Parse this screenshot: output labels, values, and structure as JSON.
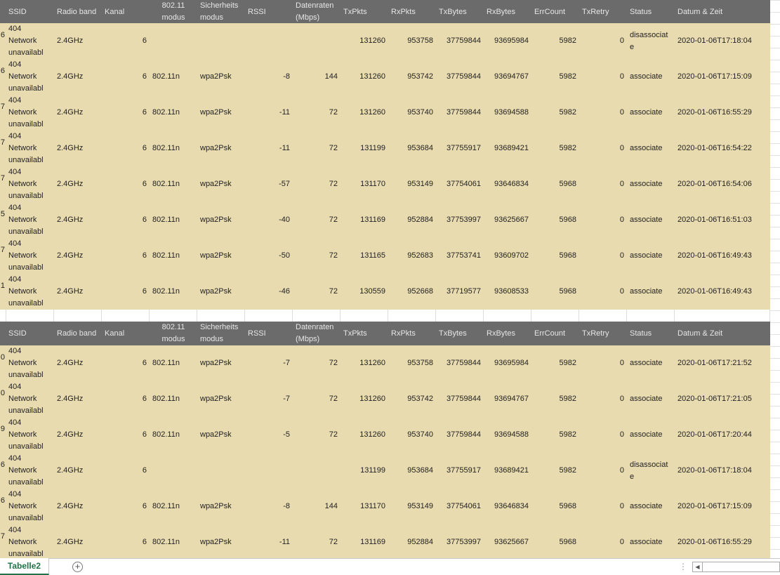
{
  "headers": [
    "",
    "SSID",
    "Radio band",
    "Kanal",
    "802.11 modus",
    "Sicherheits modus",
    "RSSI",
    "Datenraten (Mbps)",
    "TxPkts",
    "RxPkts",
    "TxBytes",
    "RxBytes",
    "ErrCount",
    "TxRetry",
    "Status",
    "Datum & Zeit"
  ],
  "ssid_lines": [
    "404",
    "Network",
    "unavailabl"
  ],
  "table1": [
    [
      "6",
      "404 Network unavailabl",
      "2.4GHz",
      "6",
      "",
      "",
      "",
      "",
      "131260",
      "953758",
      "37759844",
      "93695984",
      "5982",
      "0",
      "disassociate",
      "2020-01-06T17:18:04"
    ],
    [
      "6",
      "404 Network unavailabl",
      "2.4GHz",
      "6",
      "802.11n",
      "wpa2Psk",
      "-8",
      "144",
      "131260",
      "953742",
      "37759844",
      "93694767",
      "5982",
      "0",
      "associate",
      "2020-01-06T17:15:09"
    ],
    [
      "7",
      "404 Network unavailabl",
      "2.4GHz",
      "6",
      "802.11n",
      "wpa2Psk",
      "-11",
      "72",
      "131260",
      "953740",
      "37759844",
      "93694588",
      "5982",
      "0",
      "associate",
      "2020-01-06T16:55:29"
    ],
    [
      "7",
      "404 Network unavailabl",
      "2.4GHz",
      "6",
      "802.11n",
      "wpa2Psk",
      "-11",
      "72",
      "131199",
      "953684",
      "37755917",
      "93689421",
      "5982",
      "0",
      "associate",
      "2020-01-06T16:54:22"
    ],
    [
      "7",
      "404 Network unavailabl",
      "2.4GHz",
      "6",
      "802.11n",
      "wpa2Psk",
      "-57",
      "72",
      "131170",
      "953149",
      "37754061",
      "93646834",
      "5968",
      "0",
      "associate",
      "2020-01-06T16:54:06"
    ],
    [
      "5",
      "404 Network unavailabl",
      "2.4GHz",
      "6",
      "802.11n",
      "wpa2Psk",
      "-40",
      "72",
      "131169",
      "952884",
      "37753997",
      "93625667",
      "5968",
      "0",
      "associate",
      "2020-01-06T16:51:03"
    ],
    [
      "7",
      "404 Network unavailabl",
      "2.4GHz",
      "6",
      "802.11n",
      "wpa2Psk",
      "-50",
      "72",
      "131165",
      "952683",
      "37753741",
      "93609702",
      "5968",
      "0",
      "associate",
      "2020-01-06T16:49:43"
    ],
    [
      "1",
      "404 Network unavailabl",
      "2.4GHz",
      "6",
      "802.11n",
      "wpa2Psk",
      "-46",
      "72",
      "130559",
      "952668",
      "37719577",
      "93608533",
      "5968",
      "0",
      "associate",
      "2020-01-06T16:49:43"
    ]
  ],
  "table2": [
    [
      "0",
      "404 Network unavailabl",
      "2.4GHz",
      "6",
      "802.11n",
      "wpa2Psk",
      "-7",
      "72",
      "131260",
      "953758",
      "37759844",
      "93695984",
      "5982",
      "0",
      "associate",
      "2020-01-06T17:21:52"
    ],
    [
      "0",
      "404 Network unavailabl",
      "2.4GHz",
      "6",
      "802.11n",
      "wpa2Psk",
      "-7",
      "72",
      "131260",
      "953742",
      "37759844",
      "93694767",
      "5982",
      "0",
      "associate",
      "2020-01-06T17:21:05"
    ],
    [
      "9",
      "404 Network unavailabl",
      "2.4GHz",
      "6",
      "802.11n",
      "wpa2Psk",
      "-5",
      "72",
      "131260",
      "953740",
      "37759844",
      "93694588",
      "5982",
      "0",
      "associate",
      "2020-01-06T17:20:44"
    ],
    [
      "6",
      "404 Network unavailabl",
      "2.4GHz",
      "6",
      "",
      "",
      "",
      "",
      "131199",
      "953684",
      "37755917",
      "93689421",
      "5982",
      "0",
      "disassociate",
      "2020-01-06T17:18:04"
    ],
    [
      "6",
      "404 Network unavailabl",
      "2.4GHz",
      "6",
      "802.11n",
      "wpa2Psk",
      "-8",
      "144",
      "131170",
      "953149",
      "37754061",
      "93646834",
      "5968",
      "0",
      "associate",
      "2020-01-06T17:15:09"
    ],
    [
      "7",
      "404 Network unavailabl",
      "2.4GHz",
      "6",
      "802.11n",
      "wpa2Psk",
      "-11",
      "72",
      "131169",
      "952884",
      "37753997",
      "93625667",
      "5968",
      "0",
      "associate",
      "2020-01-06T16:55:29"
    ]
  ],
  "footer": {
    "sheet_tab": "Tabelle2",
    "add_sheet": "+",
    "dots": "⋮",
    "scroll_left": "◀"
  },
  "colors": {
    "header_bg": "#6b6b6b",
    "row_bg": "#e9dbb0",
    "tab_accent": "#217346"
  }
}
